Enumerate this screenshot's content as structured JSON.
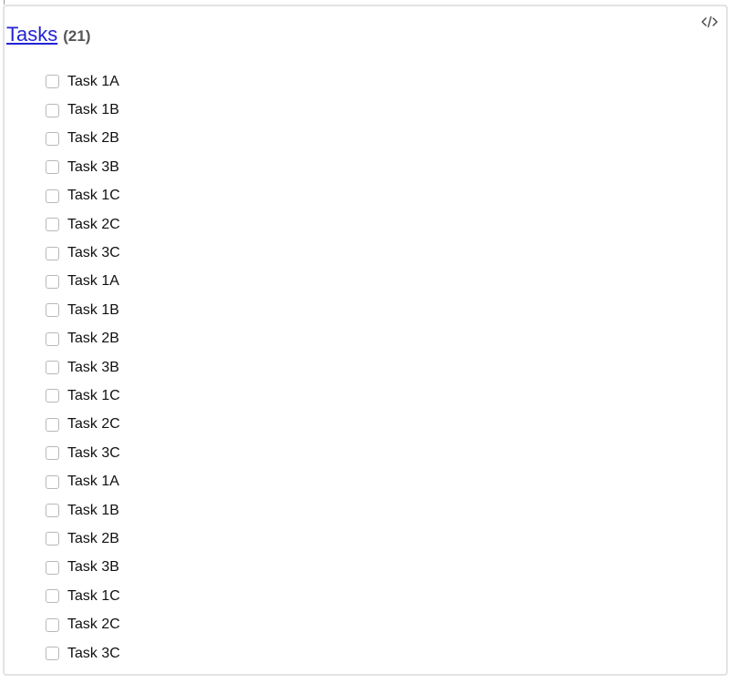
{
  "widget": {
    "title": "Tasks",
    "count": "(21)",
    "code_icon": "code-brackets-icon"
  },
  "tasks": [
    {
      "label": "Task 1A",
      "checked": false
    },
    {
      "label": "Task 1B",
      "checked": false
    },
    {
      "label": "Task 2B",
      "checked": false
    },
    {
      "label": "Task 3B",
      "checked": false
    },
    {
      "label": "Task 1C",
      "checked": false
    },
    {
      "label": "Task 2C",
      "checked": false
    },
    {
      "label": "Task 3C",
      "checked": false
    },
    {
      "label": "Task 1A",
      "checked": false
    },
    {
      "label": "Task 1B",
      "checked": false
    },
    {
      "label": "Task 2B",
      "checked": false
    },
    {
      "label": "Task 3B",
      "checked": false
    },
    {
      "label": "Task 1C",
      "checked": false
    },
    {
      "label": "Task 2C",
      "checked": false
    },
    {
      "label": "Task 3C",
      "checked": false
    },
    {
      "label": "Task 1A",
      "checked": false
    },
    {
      "label": "Task 1B",
      "checked": false
    },
    {
      "label": "Task 2B",
      "checked": false
    },
    {
      "label": "Task 3B",
      "checked": false
    },
    {
      "label": "Task 1C",
      "checked": false
    },
    {
      "label": "Task 2C",
      "checked": false
    },
    {
      "label": "Task 3C",
      "checked": false
    }
  ]
}
